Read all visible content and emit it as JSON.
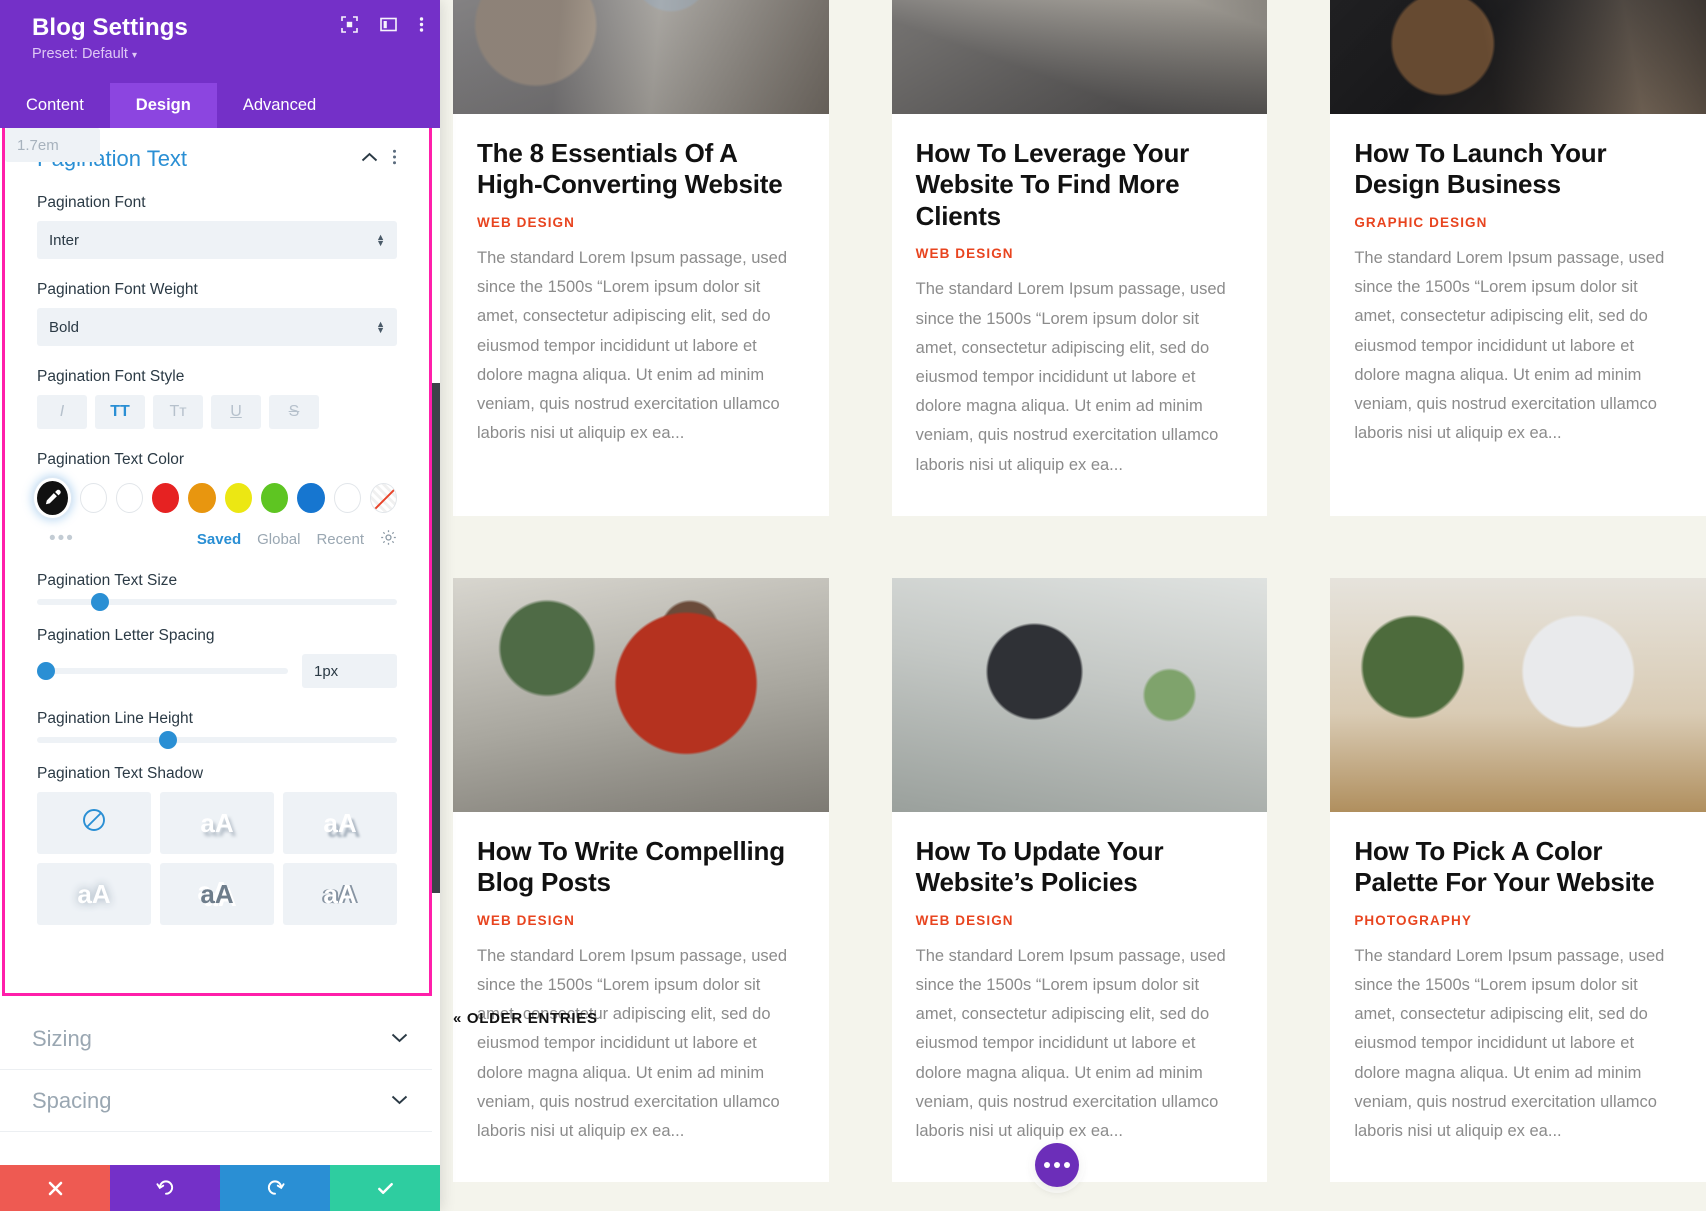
{
  "panel": {
    "title": "Blog Settings",
    "preset": "Preset: Default",
    "preset_caret": "▾",
    "header_icons": [
      "focus-icon",
      "layout-icon",
      "more-vertical-icon"
    ],
    "tabs": [
      {
        "label": "Content",
        "active": false
      },
      {
        "label": "Design",
        "active": true
      },
      {
        "label": "Advanced",
        "active": false
      }
    ],
    "section": {
      "title": "Pagination Text",
      "collapse_icon": "chevron-up-icon",
      "more_icon": "more-vertical-icon"
    },
    "fields": {
      "font": {
        "label": "Pagination Font",
        "value": "Inter"
      },
      "font_weight": {
        "label": "Pagination Font Weight",
        "value": "Bold"
      },
      "font_style": {
        "label": "Pagination Font Style",
        "options": [
          {
            "glyph": "I",
            "name": "italic",
            "active": false
          },
          {
            "glyph": "TT",
            "name": "uppercase",
            "active": true
          },
          {
            "glyph": "Tᴛ",
            "name": "small-caps",
            "active": false
          },
          {
            "glyph": "U",
            "name": "underline",
            "active": false
          },
          {
            "glyph": "S",
            "name": "strikethrough",
            "active": false
          }
        ]
      },
      "text_color": {
        "label": "Pagination Text Color",
        "picker_icon": "eyedropper-icon",
        "swatches": [
          "#ffffff",
          "#ffffff",
          "#e62222",
          "#e8960f",
          "#ece713",
          "#5ec522",
          "#1676d0",
          "#ffffff",
          "transparent"
        ],
        "more_dots": "•••",
        "tabs": [
          {
            "label": "Saved",
            "active": true
          },
          {
            "label": "Global",
            "active": false
          },
          {
            "label": "Recent",
            "active": false
          }
        ],
        "settings_icon": "gear-icon"
      },
      "text_size": {
        "label": "Pagination Text Size",
        "value": "14px",
        "is_placeholder": true,
        "percent": 15
      },
      "letter_spacing": {
        "label": "Pagination Letter Spacing",
        "value": "1px",
        "is_placeholder": false,
        "percent": 2
      },
      "line_height": {
        "label": "Pagination Line Height",
        "value": "1.7em",
        "is_placeholder": true,
        "percent": 34
      },
      "text_shadow": {
        "label": "Pagination Text Shadow",
        "options": [
          "none",
          "aA",
          "aA",
          "aA",
          "aA",
          "aA"
        ]
      }
    },
    "collapsed_sections": [
      {
        "label": "Sizing",
        "icon": "chevron-down-icon"
      },
      {
        "label": "Spacing",
        "icon": "chevron-down-icon"
      }
    ],
    "footer": [
      {
        "name": "cancel",
        "icon": "✕"
      },
      {
        "name": "undo",
        "icon": "↺"
      },
      {
        "name": "redo",
        "icon": "↻"
      },
      {
        "name": "save",
        "icon": "✓"
      }
    ]
  },
  "preview": {
    "accent_category_color": "#e8441f",
    "background": "#f4f4ec",
    "older_entries": "« Older Entries",
    "fab_icon": "ellipsis-icon",
    "body_text": "The standard Lorem Ipsum passage, used since the 1500s “Lorem ipsum dolor sit amet, consectetur adipiscing elit, sed do eiusmod tempor incididunt ut labore et dolore magna aliqua. Ut enim ad minim veniam, quis nostrud exercitation ullamco laboris nisi ut aliquip ex ea...",
    "cards": [
      {
        "title": "The 8 Essentials Of A High-Converting Website",
        "category": "Web Design"
      },
      {
        "title": "How To Leverage Your Website To Find More Clients",
        "category": "Web Design"
      },
      {
        "title": "How To Launch Your Design Business",
        "category": "Graphic Design"
      },
      {
        "title": "How To Write Compelling Blog Posts",
        "category": "Web Design"
      },
      {
        "title": "How To Update Your Website’s Policies",
        "category": "Web Design"
      },
      {
        "title": "How To Pick A Color Palette For Your Website",
        "category": "Photography"
      }
    ]
  }
}
